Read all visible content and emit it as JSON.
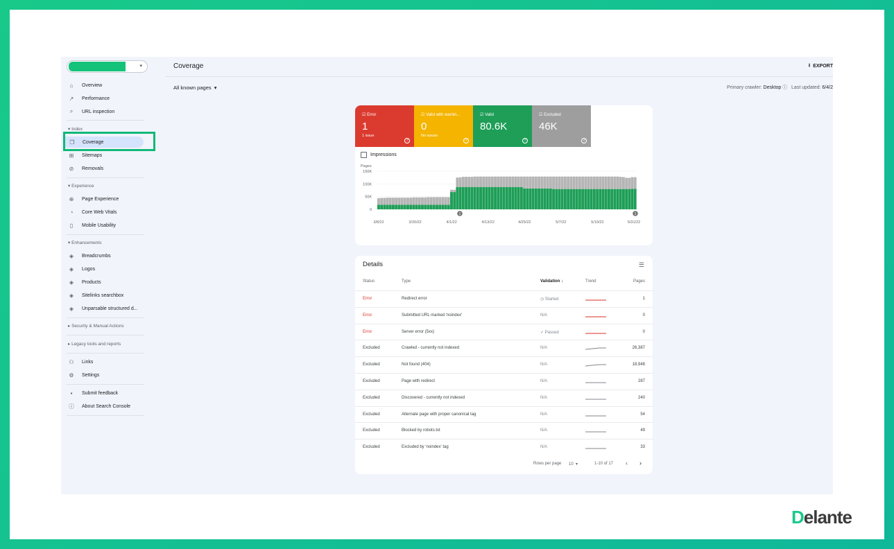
{
  "app": {
    "title": "Coverage",
    "export_label": "EXPORT",
    "filter": "All known pages",
    "crawler_label": "Primary crawler:",
    "crawler_value": "Desktop",
    "updated_label": "Last updated:",
    "updated_value": "6/4/2",
    "brand_color": "#18c98a"
  },
  "sidebar": {
    "top_items": [
      {
        "label": "Overview",
        "icon": "home-icon"
      },
      {
        "label": "Performance",
        "icon": "trending-icon"
      },
      {
        "label": "URL inspection",
        "icon": "search-icon"
      }
    ],
    "sections": {
      "index": "Index",
      "experience": "Experience",
      "enhancements": "Enhancements",
      "security": "Security & Manual Actions",
      "legacy": "Legacy tools and reports"
    },
    "index_items": [
      {
        "label": "Coverage",
        "icon": "coverage-icon",
        "active": true
      },
      {
        "label": "Sitemaps",
        "icon": "sitemap-icon"
      },
      {
        "label": "Removals",
        "icon": "removals-icon"
      }
    ],
    "experience_items": [
      {
        "label": "Page Experience",
        "icon": "plus-circle-icon"
      },
      {
        "label": "Core Web Vitals",
        "icon": "speedometer-icon"
      },
      {
        "label": "Mobile Usability",
        "icon": "mobile-icon"
      }
    ],
    "enhancement_items": [
      {
        "label": "Breadcrumbs",
        "icon": "layers-icon"
      },
      {
        "label": "Logos",
        "icon": "layers-icon"
      },
      {
        "label": "Products",
        "icon": "layers-icon"
      },
      {
        "label": "Sitelinks searchbox",
        "icon": "layers-icon"
      },
      {
        "label": "Unparsable structured d...",
        "icon": "layers-icon"
      }
    ],
    "bottom_items": [
      {
        "label": "Links",
        "icon": "links-icon"
      },
      {
        "label": "Settings",
        "icon": "gear-icon"
      }
    ],
    "footer_items": [
      {
        "label": "Submit feedback",
        "icon": "feedback-icon"
      },
      {
        "label": "About Search Console",
        "icon": "info-icon"
      }
    ]
  },
  "tiles": [
    {
      "label": "Error",
      "value": "1",
      "sub": "1 issue",
      "color": "#db3b2f"
    },
    {
      "label": "Valid with warnin...",
      "value": "0",
      "sub": "No issues",
      "color": "#f4b400"
    },
    {
      "label": "Valid",
      "value": "80.6K",
      "sub": "",
      "color": "#1e9e57"
    },
    {
      "label": "Excluded",
      "value": "46K",
      "sub": "",
      "color": "#9e9e9e"
    }
  ],
  "impressions_label": "Impressions",
  "chart_data": {
    "type": "bar",
    "ylabel": "Pages",
    "yticks": [
      "150K",
      "100K",
      "50K",
      "0"
    ],
    "ylim": [
      0,
      150000
    ],
    "xticks": [
      "3/8/22",
      "3/20/22",
      "4/1/22",
      "4/13/22",
      "4/25/22",
      "5/7/22",
      "5/19/22",
      "5/31/22"
    ],
    "series": [
      {
        "name": "Valid",
        "color": "#1e9e57",
        "values": [
          18000,
          18000,
          18000,
          18000,
          18000,
          18000,
          18000,
          18000,
          18000,
          18000,
          18000,
          18000,
          18000,
          18000,
          18000,
          18000,
          18000,
          18000,
          18000,
          18000,
          18000,
          18000,
          18000,
          18000,
          18000,
          68000,
          68000,
          88000,
          88000,
          88000,
          88000,
          88000,
          88000,
          88000,
          88000,
          88000,
          88000,
          88000,
          88000,
          88000,
          88000,
          88000,
          88000,
          88000,
          88000,
          88000,
          88000,
          88000,
          88000,
          88000,
          82000,
          82000,
          82000,
          82000,
          82000,
          82000,
          82000,
          82000,
          82000,
          82000,
          80000,
          80000,
          80000,
          80000,
          80000,
          80000,
          80000,
          80000,
          80000,
          80000,
          80000,
          80000,
          80000,
          80000,
          80000,
          80000,
          80000,
          80000,
          80000,
          80000,
          80000,
          80000,
          80000,
          80000,
          80000,
          80000,
          80000,
          80600,
          80600
        ]
      },
      {
        "name": "Excluded",
        "color": "#b5b5b5",
        "values": [
          26000,
          27000,
          27000,
          28000,
          28000,
          28000,
          28000,
          28000,
          28000,
          28000,
          28000,
          28000,
          29000,
          29000,
          29000,
          29000,
          29000,
          30000,
          30000,
          30000,
          30000,
          30000,
          30000,
          30000,
          30000,
          9000,
          9000,
          37000,
          38000,
          40000,
          40000,
          40000,
          40000,
          41000,
          41000,
          41000,
          41000,
          41000,
          41000,
          41000,
          41000,
          41000,
          41000,
          41000,
          41000,
          41000,
          41000,
          41000,
          41000,
          41000,
          47000,
          47000,
          47000,
          47000,
          47000,
          47000,
          47000,
          47000,
          47000,
          47000,
          49000,
          49000,
          49000,
          49000,
          49000,
          49000,
          49000,
          49000,
          49000,
          49000,
          49000,
          49000,
          49000,
          49000,
          49000,
          49000,
          49000,
          49000,
          49000,
          49000,
          49000,
          49000,
          49000,
          48000,
          47000,
          44000,
          44000,
          46000,
          46000
        ]
      }
    ],
    "annotations": [
      "1",
      "1"
    ]
  },
  "details": {
    "title": "Details",
    "headers": {
      "status": "Status",
      "type": "Type",
      "validation": "Validation",
      "trend": "Trend",
      "pages": "Pages"
    },
    "rows": [
      {
        "status": "Error",
        "type": "Redirect error",
        "validation": "Started",
        "pages": "1"
      },
      {
        "status": "Error",
        "type": "Submitted URL marked 'noindex'",
        "validation": "N/A",
        "pages": "0"
      },
      {
        "status": "Error",
        "type": "Server error (5xx)",
        "validation": "Passed",
        "pages": "0"
      },
      {
        "status": "Excluded",
        "type": "Crawled - currently not indexed",
        "validation": "N/A",
        "pages": "26,387"
      },
      {
        "status": "Excluded",
        "type": "Not found (404)",
        "validation": "N/A",
        "pages": "18,948"
      },
      {
        "status": "Excluded",
        "type": "Page with redirect",
        "validation": "N/A",
        "pages": "287"
      },
      {
        "status": "Excluded",
        "type": "Discovered - currently not indexed",
        "validation": "N/A",
        "pages": "240"
      },
      {
        "status": "Excluded",
        "type": "Alternate page with proper canonical tag",
        "validation": "N/A",
        "pages": "54"
      },
      {
        "status": "Excluded",
        "type": "Blocked by robots.txt",
        "validation": "N/A",
        "pages": "49"
      },
      {
        "status": "Excluded",
        "type": "Excluded by 'noindex' tag",
        "validation": "N/A",
        "pages": "33"
      }
    ],
    "rows_per_page_label": "Rows per page",
    "rows_per_page": "10",
    "range": "1-10 of 17"
  },
  "brand_logo": "Delante"
}
